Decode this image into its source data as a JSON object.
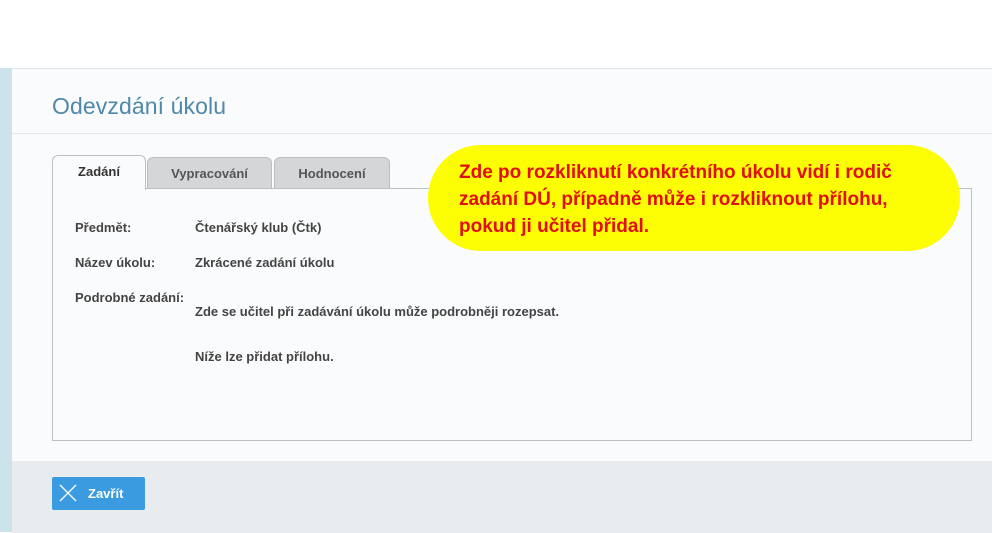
{
  "dialog": {
    "title": "Odevzdání úkolu"
  },
  "tabs": [
    {
      "label": "Zadání",
      "active": true
    },
    {
      "label": "Vypracování",
      "active": false
    },
    {
      "label": "Hodnocení",
      "active": false
    }
  ],
  "assignment": {
    "subject_label": "Předmět:",
    "subject_value": "Čtenářský klub (Čtk)",
    "name_label": "Název úkolu:",
    "name_value": "Zkrácené zadání úkolu",
    "detail_label": "Podrobné zadání:",
    "detail_lines": [
      "Zde se učitel při zadávání úkolu může podrobněji rozepsat.",
      "Níže lze přidat přílohu."
    ]
  },
  "footer": {
    "close_label": "Zavřít",
    "close_icon": "close-x-icon"
  },
  "callout": {
    "lines": [
      "Zde po rozkliknutí konkrétního úkolu vidí i rodič",
      "zadání DÚ, případně může i rozkliknout přílohu,",
      "pokud ji učitel přidal."
    ]
  },
  "colors": {
    "title": "#4f88aa",
    "button": "#3a9be0",
    "callout_bg": "#fdfd04",
    "callout_text": "#e10f0f"
  }
}
